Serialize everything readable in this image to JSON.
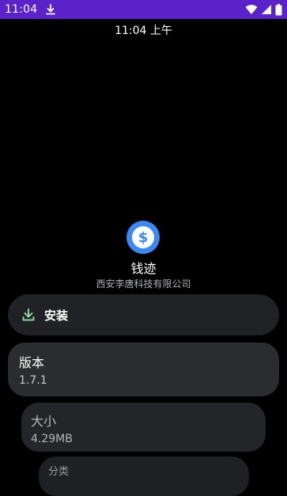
{
  "status_bar": {
    "time": "11:04",
    "accent": "#5a22c8",
    "icons": [
      "download-icon",
      "wifi-icon",
      "signal-icon",
      "battery-icon"
    ]
  },
  "lock_clock": "11:04 上午",
  "app": {
    "name": "钱迹",
    "developer": "西安李唐科技有限公司",
    "icon_color": "#3b8af3"
  },
  "install_button": {
    "label": "安装",
    "icon": "download-icon",
    "icon_color": "#8fd49a"
  },
  "cards": [
    {
      "title": "版本",
      "value": "1.7.1"
    },
    {
      "title": "大小",
      "value": "4.29MB"
    },
    {
      "title": "分类"
    }
  ]
}
